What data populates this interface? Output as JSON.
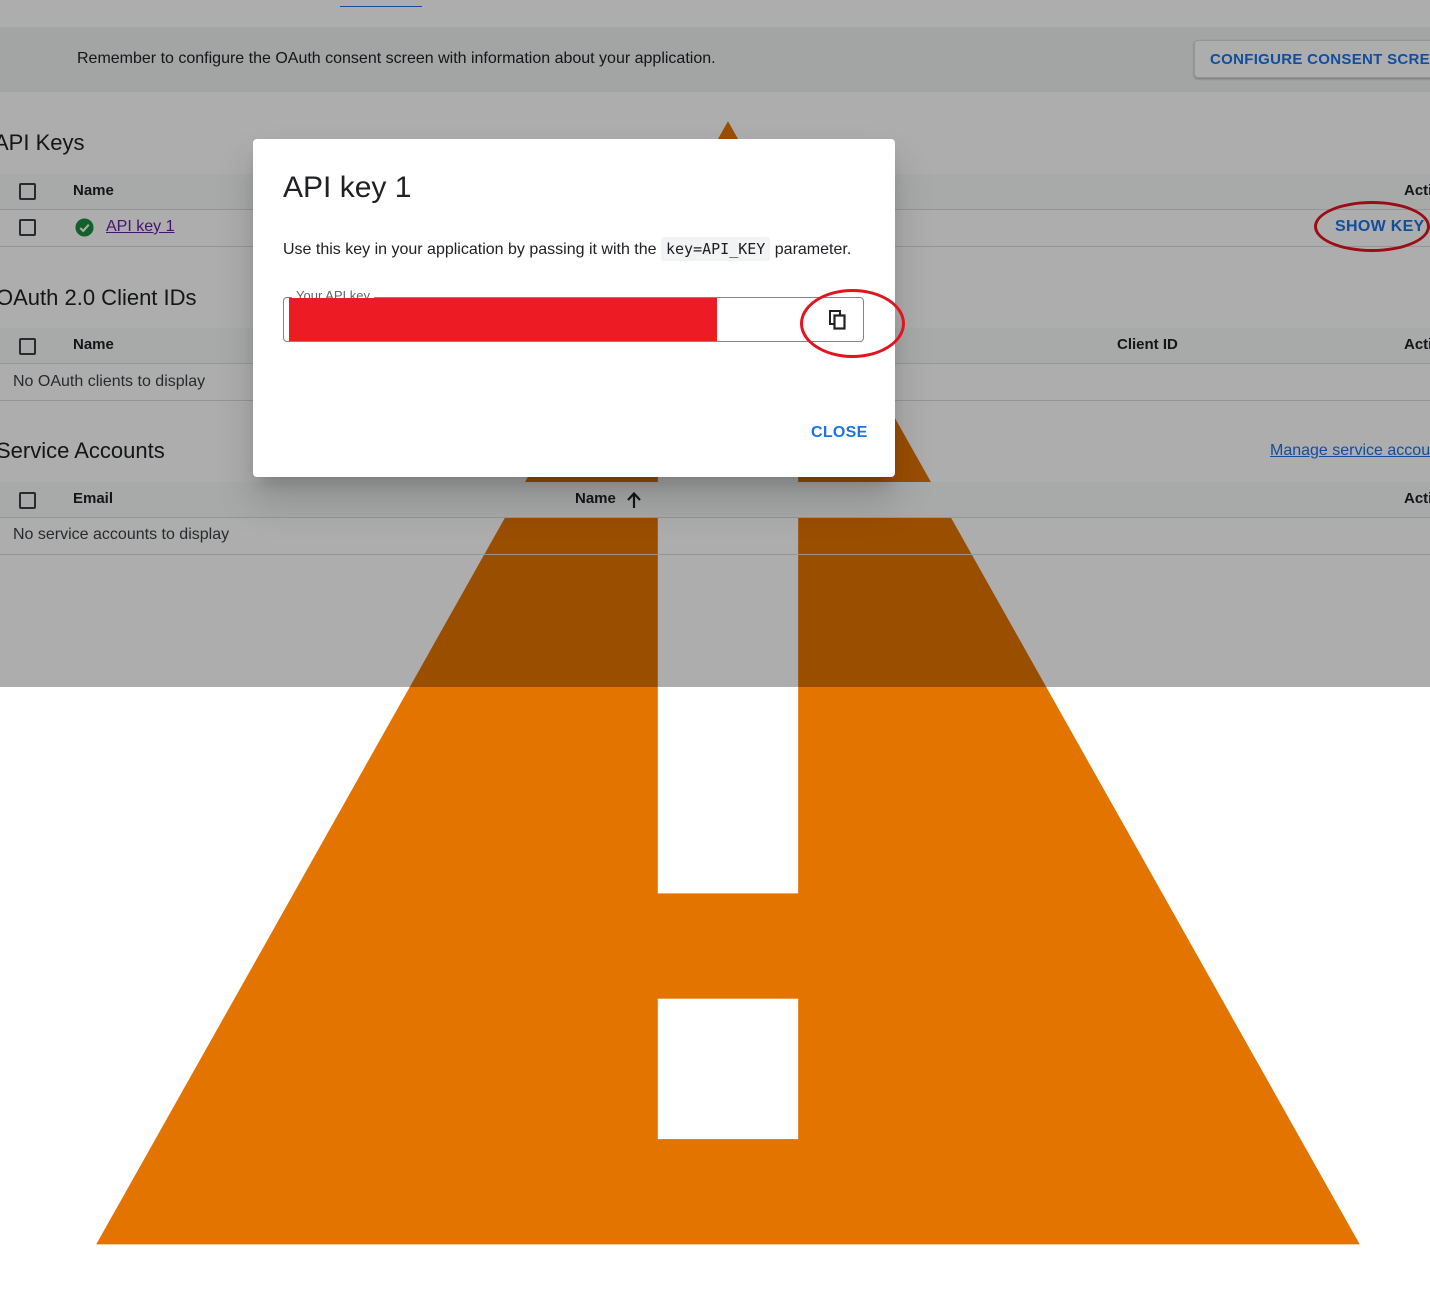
{
  "banner": {
    "text": "Remember to configure the OAuth consent screen with information about your application.",
    "button_label": "CONFIGURE CONSENT SCREEN"
  },
  "api_keys": {
    "title": "API Keys",
    "columns": {
      "name": "Name",
      "actions": "Actions"
    },
    "rows": [
      {
        "name": "API key 1",
        "action": "SHOW KEY"
      }
    ]
  },
  "oauth": {
    "title": "OAuth 2.0 Client IDs",
    "columns": {
      "name": "Name",
      "client_id": "Client ID",
      "actions": "Actions"
    },
    "empty_text": "No OAuth clients to display"
  },
  "service_accounts": {
    "title": "Service Accounts",
    "manage_link": "Manage service accounts",
    "columns": {
      "email": "Email",
      "name": "Name",
      "actions": "Actions"
    },
    "empty_text": "No service accounts to display"
  },
  "dialog": {
    "title": "API key 1",
    "text_before": "Use this key in your application by passing it with the",
    "code": "key=API_KEY",
    "text_after": "parameter.",
    "field_label": "Your API key",
    "close_label": "CLOSE"
  },
  "colors": {
    "accent": "#1a73e8",
    "annotation": "#e3141f",
    "redaction": "#ed1c24",
    "success": "#1e8e3e",
    "warning": "#e37400"
  }
}
